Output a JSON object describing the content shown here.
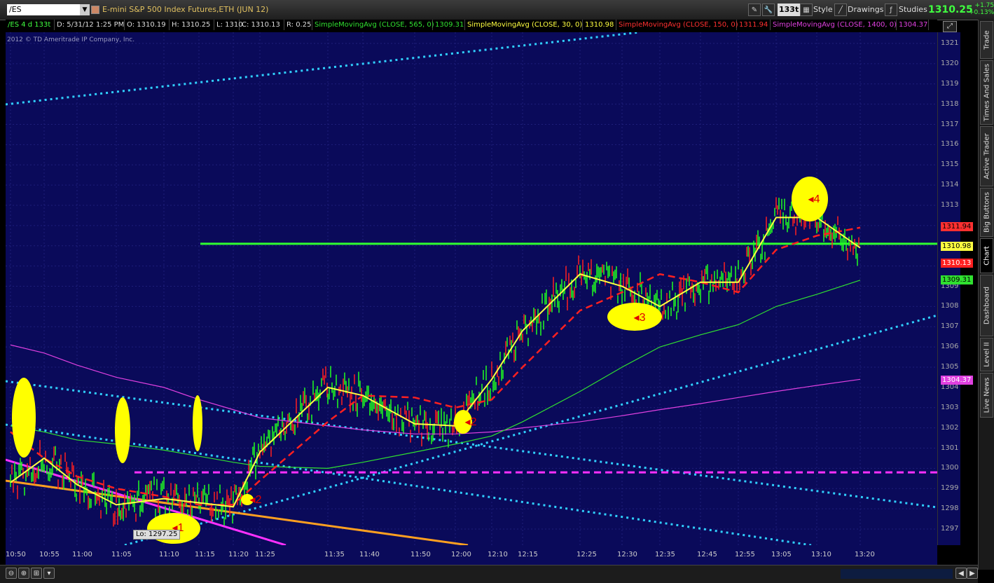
{
  "header": {
    "symbol": "/ES",
    "description": "E-mini S&P 500 Index Futures,ETH (JUN 12)",
    "badge": "133t",
    "style_label": "Style",
    "drawings_label": "Drawings",
    "studies_label": "Studies",
    "last_price": "1310.25",
    "change_abs": "+1.75",
    "change_pct": "+0.13%"
  },
  "infobar": {
    "name": "/ES 4 d 133t",
    "date": "D: 5/31/12 1:25 PM",
    "open": "O: 1310.19",
    "high": "H: 1310.25",
    "low": "L: 1310",
    "close": "C: 1310.13",
    "range": "R: 0.25",
    "sma565_label": "SimpleMovingAvg (CLOSE, 565, 0)",
    "sma565_value": "1309.31",
    "sma30_label": "SimpleMovingAvg (CLOSE, 30, 0)",
    "sma30_value": "1310.98",
    "sma150_label": "SimpleMovingAvg (CLOSE, 150, 0)",
    "sma150_value": "1311.94",
    "sma1400_label": "SimpleMovingAvg (CLOSE, 1400, 0)",
    "sma1400_value": "1304.37"
  },
  "copyright": "2012 © TD Ameritrade IP Company, Inc.",
  "colors": {
    "plot_bg": "#0a0a5a",
    "sma565": "#30e030",
    "sma30": "#ffff40",
    "sma150": "#ff2020",
    "sma1400": "#e040e0",
    "up_bar": "#20ff20",
    "down_bar": "#ff2020",
    "horizontal_line": "#30ff30",
    "trend_dotted": "#30d0ff",
    "support_dashed": "#ff30ff",
    "trend_orange": "#ffa020",
    "annotation": "#ffff00"
  },
  "y_axis": {
    "ticks": [
      "1321",
      "1320",
      "1319",
      "1318",
      "1317",
      "1316",
      "1315",
      "1314",
      "1313",
      "1312",
      "1311",
      "1310",
      "1309",
      "1308",
      "1307",
      "1306",
      "1305",
      "1304",
      "1303",
      "1302",
      "1301",
      "1300",
      "1299",
      "1298",
      "1297"
    ],
    "labels": {
      "sma150": "1311.94",
      "sma30": "1310.98",
      "last": "1310.13",
      "sma565": "1309.31",
      "sma1400": "1304.37"
    }
  },
  "x_axis": {
    "ticks": [
      "10:50",
      "10:55",
      "11:00",
      "11:05",
      "11:10",
      "11:15",
      "11:20",
      "11:25",
      "11:35",
      "11:40",
      "11:50",
      "12:00",
      "12:10",
      "12:15",
      "12:25",
      "12:30",
      "12:35",
      "12:45",
      "12:55",
      "13:05",
      "13:10",
      "13:20"
    ]
  },
  "low_label": "Lo: 1297.25",
  "annotations": [
    "1",
    "2",
    "3",
    "4"
  ],
  "side_tabs": [
    "Trade",
    "Times And Sales",
    "Active Trader",
    "Big Buttons",
    "Chart",
    "Dashboard",
    "Level II",
    "Live News"
  ],
  "active_tab": "Chart",
  "chart_data": {
    "type": "line",
    "title": "E-mini S&P 500 Index Futures,ETH (JUN 12)",
    "xlabel": "",
    "ylabel": "",
    "ylim": [
      1296.5,
      1321.5
    ],
    "x": [
      "10:50",
      "10:55",
      "11:00",
      "11:05",
      "11:10",
      "11:15",
      "11:20",
      "11:25",
      "11:35",
      "11:40",
      "11:50",
      "12:00",
      "12:10",
      "12:15",
      "12:25",
      "12:30",
      "12:35",
      "12:45",
      "12:55",
      "13:05",
      "13:10",
      "13:20"
    ],
    "series": [
      {
        "name": "SimpleMovingAvg (CLOSE, 30, 0)",
        "values": [
          1299.3,
          1300.5,
          1299.2,
          1298.2,
          1298.5,
          1298.3,
          1298.1,
          1300.8,
          1304.0,
          1303.6,
          1302.2,
          1302.1,
          1304.4,
          1306.8,
          1309.6,
          1309.0,
          1308.0,
          1309.2,
          1309.2,
          1312.4,
          1312.4,
          1310.9
        ]
      },
      {
        "name": "SimpleMovingAvg (CLOSE, 150, 0)",
        "values": [
          1301.8,
          1300.5,
          1299.6,
          1299.0,
          1298.6,
          1298.2,
          1298.2,
          1299.4,
          1302.3,
          1303.6,
          1303.5,
          1303.0,
          1303.4,
          1305.0,
          1307.8,
          1308.7,
          1309.6,
          1309.2,
          1308.7,
          1310.8,
          1311.5,
          1311.9
        ]
      },
      {
        "name": "SimpleMovingAvg (CLOSE, 565, 0)",
        "values": [
          1302.1,
          1301.8,
          1301.4,
          1301.2,
          1300.9,
          1300.6,
          1300.3,
          1300.1,
          1300.0,
          1300.3,
          1300.8,
          1301.2,
          1301.6,
          1302.3,
          1303.8,
          1305.0,
          1306.0,
          1306.6,
          1307.1,
          1308.0,
          1308.6,
          1309.3
        ]
      },
      {
        "name": "SimpleMovingAvg (CLOSE, 1400, 0)",
        "values": [
          1306.1,
          1305.7,
          1305.1,
          1304.5,
          1304.0,
          1303.4,
          1302.9,
          1302.5,
          1302.1,
          1301.9,
          1301.7,
          1301.7,
          1301.8,
          1302.0,
          1302.3,
          1302.6,
          1302.9,
          1303.2,
          1303.5,
          1303.8,
          1304.1,
          1304.4
        ]
      }
    ],
    "horizontal_line": 1311.1,
    "support_line": 1299.8,
    "grid": true,
    "legend": "top"
  }
}
